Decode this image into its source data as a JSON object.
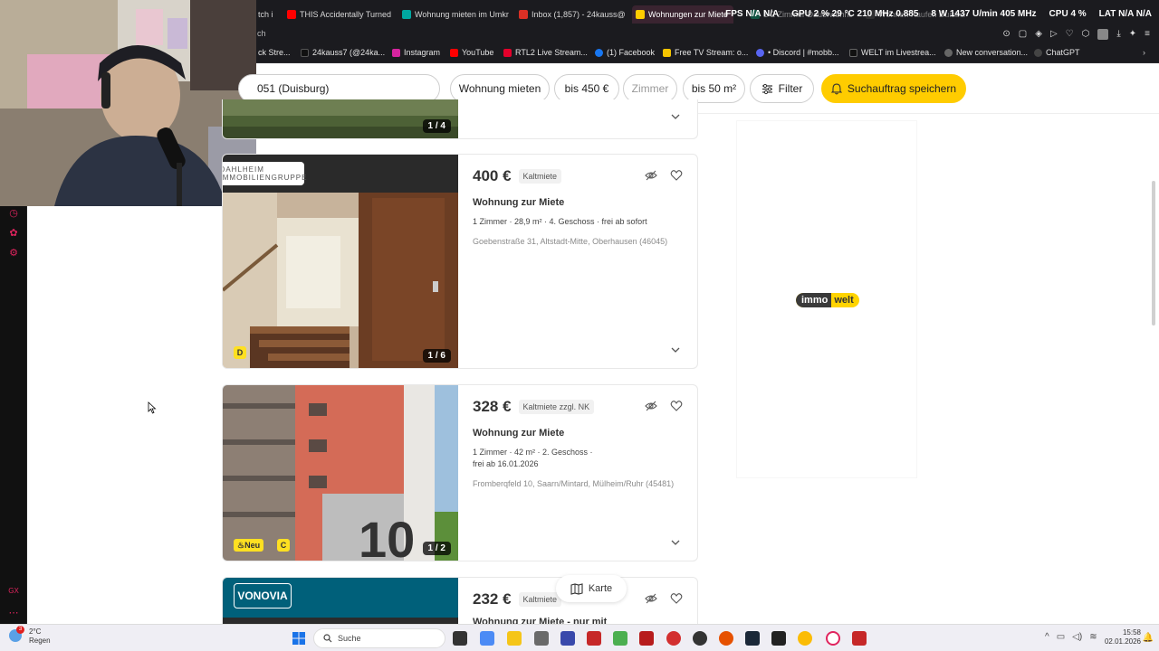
{
  "browser": {
    "tabs": [
      {
        "label": "tch i",
        "color": "#9146ff"
      },
      {
        "label": "THIS Accidentally Turned",
        "color": "#ff0000"
      },
      {
        "label": "Wohnung mieten im Umkr",
        "color": "#00a7a0"
      },
      {
        "label": "Inbox (1,857) - 24kauss@",
        "color": "#d93025"
      },
      {
        "label": "Wohnungen zur Miete",
        "color": "#ffcc00",
        "active": true
      },
      {
        "label": "1-2 Zimmer Dauerwohnu",
        "color": "#0b7a5a"
      },
      {
        "label": "Wohnen Kaufen Duisburg",
        "color": "#444"
      }
    ],
    "url_fragment": "ch",
    "bookmarks": [
      {
        "label": "ck Stre...",
        "color": "#888"
      },
      {
        "label": "24kauss7 (@24ka...",
        "color": "#111"
      },
      {
        "label": "Instagram",
        "color": "#d6249f"
      },
      {
        "label": "YouTube",
        "color": "#ff0000"
      },
      {
        "label": "RTL2 Live Stream...",
        "color": "#e4002b"
      },
      {
        "label": "(1) Facebook",
        "color": "#1877f2"
      },
      {
        "label": "Free TV Stream: o...",
        "color": "#f5c400"
      },
      {
        "label": "• Discord | #mobb...",
        "color": "#5865f2"
      },
      {
        "label": "WELT im Livestrea...",
        "color": "#111"
      },
      {
        "label": "New conversation...",
        "color": "#666"
      },
      {
        "label": "ChatGPT",
        "color": "#444"
      }
    ]
  },
  "overlay_stats": {
    "fps": "FPS N/A N/A",
    "gpu": "GPU 2 % 29 °C 210 MHz 0.885",
    "fan": "8 W 1437 U/min 405 MHz",
    "cpu": "CPU 4 %",
    "lat": "LAT N/A N/A"
  },
  "filters": {
    "location": "051 (Duisburg)",
    "type": "Wohnung mieten",
    "price": "bis 450 €",
    "rooms_placeholder": "Zimmer",
    "area": "bis 50 m²",
    "filter_label": "Filter",
    "save_label": "Suchauftrag speichern"
  },
  "listings": [
    {
      "counter": "1 / 4"
    },
    {
      "price": "400 €",
      "price_type": "Kaltmiete",
      "title": "Wohnung zur Miete",
      "facts": [
        "1 Zimmer",
        "28,9 m²",
        "4. Geschoss",
        "frei ab sofort"
      ],
      "address": "Goebenstraße 31, Altstadt-Mitte, Oberhausen (46045)",
      "counter": "1 / 6",
      "energy_badge": "D",
      "provider_logo": "DAHLHEIM IMMOBILIENGRUPPE"
    },
    {
      "price": "328 €",
      "price_type": "Kaltmiete zzgl. NK",
      "title": "Wohnung zur Miete",
      "facts_line1": [
        "1 Zimmer",
        "42 m²",
        "2. Geschoss"
      ],
      "facts_line2": "frei ab 16.01.2026",
      "address": "Fromberqfeld 10, Saarn/Mintard, Mülheim/Ruhr (45481)",
      "counter": "1 / 2",
      "new_badge": "Neu",
      "energy_badge": "C"
    },
    {
      "price": "232 €",
      "price_type": "Kaltmiete",
      "title": "Wohnung zur Miete - nur mit",
      "provider_logo": "VONOVIA"
    }
  ],
  "ad": {
    "logo_left": "immo",
    "logo_right": "welt"
  },
  "map_button": "Karte",
  "taskbar": {
    "weather_temp": "2°C",
    "weather_text": "Regen",
    "search_placeholder": "Suche",
    "time": "15:58",
    "date": "02.01.2026",
    "notification_count": "3"
  }
}
